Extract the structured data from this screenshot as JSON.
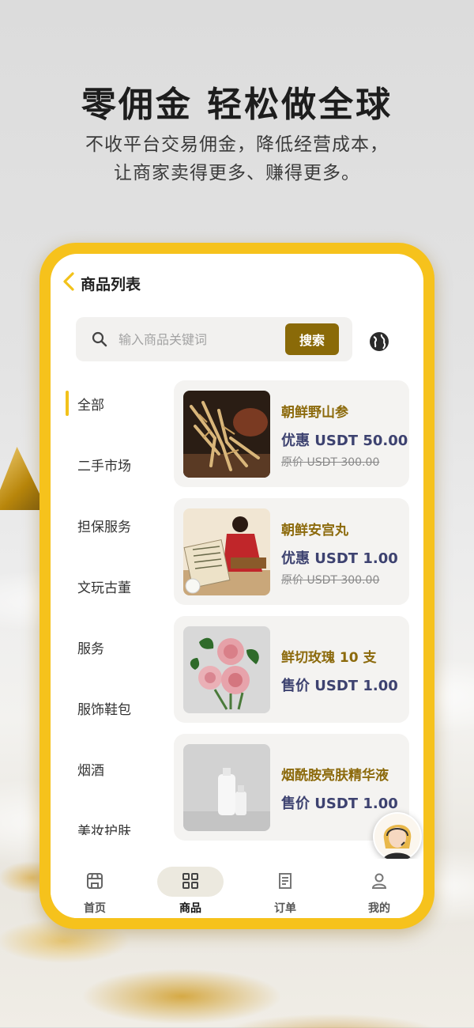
{
  "promo": {
    "headline": "零佣金 轻松做全球",
    "subline1": "不收平台交易佣金，降低经营成本，",
    "subline2": "让商家卖得更多、赚得更多。"
  },
  "app": {
    "title": "商品列表",
    "search": {
      "placeholder": "输入商品关键词",
      "button": "搜索"
    },
    "categories": [
      {
        "label": "全部",
        "active": true
      },
      {
        "label": "二手市场"
      },
      {
        "label": "担保服务"
      },
      {
        "label": "文玩古董"
      },
      {
        "label": "服务"
      },
      {
        "label": "服饰鞋包"
      },
      {
        "label": "烟酒"
      },
      {
        "label": "美妆护肤"
      }
    ],
    "products": [
      {
        "name": "朝鲜野山参",
        "price": "优惠 USDT 50.00",
        "original": "原价 USDT 300.00",
        "image": "ginseng-image"
      },
      {
        "name": "朝鲜安宫丸",
        "price": "优惠 USDT 1.00",
        "original": "原价 USDT 300.00",
        "image": "angong-pill-image"
      },
      {
        "name": "鲜切玫瑰 10 支",
        "price": "售价 USDT 1.00",
        "image": "roses-image"
      },
      {
        "name": "烟酰胺亮肤精华液",
        "price": "售价 USDT 1.00",
        "image": "serum-bottles-image"
      }
    ],
    "nav": [
      {
        "label": "首页",
        "icon": "store-icon"
      },
      {
        "label": "商品",
        "icon": "grid-icon",
        "active": true
      },
      {
        "label": "订单",
        "icon": "order-icon"
      },
      {
        "label": "我的",
        "icon": "user-icon"
      }
    ]
  },
  "colors": {
    "frame": "#f6c21c",
    "accent": "#8a6a08",
    "product_name": "#8c6a0c",
    "price": "#3d4270"
  }
}
